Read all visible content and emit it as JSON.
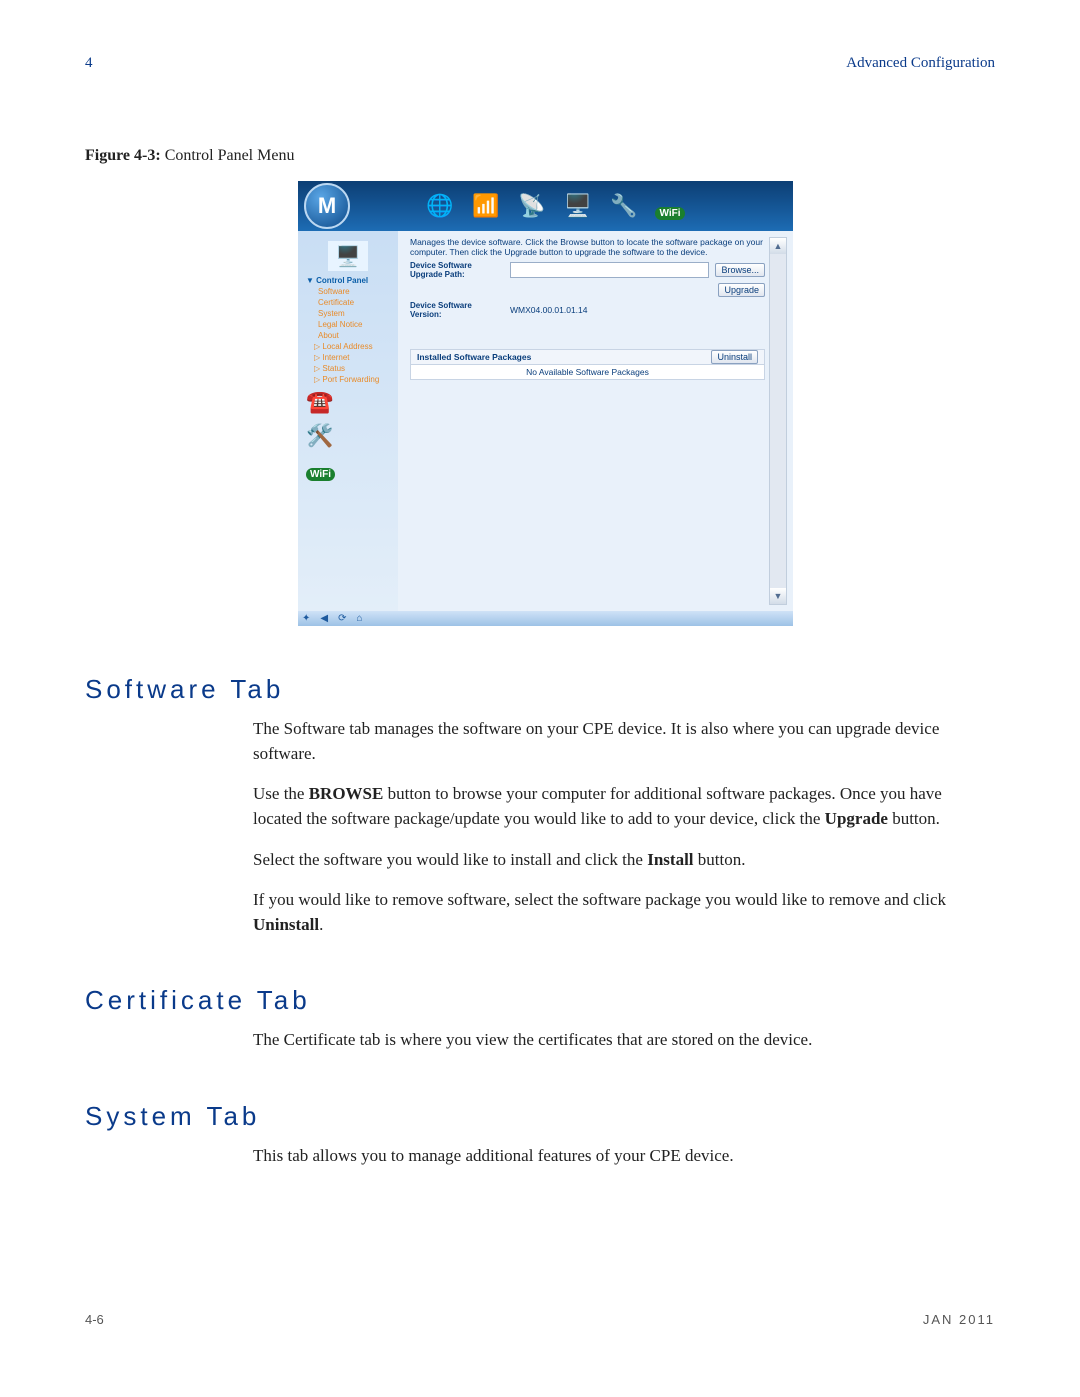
{
  "header": {
    "page_number": "4",
    "chapter_header": "Advanced Configuration"
  },
  "figure": {
    "caption_label": "Figure 4-3:",
    "caption_text": "Control Panel Menu"
  },
  "screenshot": {
    "header_icons": [
      "globe-icon",
      "signal-icon",
      "antenna-icon",
      "monitor-icon",
      "close-icon",
      "wifi-icon"
    ],
    "wifi_text": "WiFi",
    "sidebar": {
      "top_label": "Control Panel",
      "items": [
        "Software",
        "Certificate",
        "System",
        "Legal Notice",
        "About"
      ],
      "secondary": [
        "Local Address",
        "Internet",
        "Status",
        "Port Forwarding"
      ]
    },
    "main": {
      "desc": "Manages the device software. Click the Browse button to locate the software package on your computer. Then click the Upgrade button to upgrade the software to the device.",
      "path_label": "Device Software Upgrade Path:",
      "browse_btn": "Browse...",
      "upgrade_btn": "Upgrade",
      "version_label": "Device Software Version:",
      "version_value": "WMX04.00.01.01.14",
      "packages_label": "Installed Software Packages",
      "uninstall_btn": "Uninstall",
      "no_packages": "No Available Software Packages"
    }
  },
  "sections": {
    "software": {
      "heading": "Software Tab",
      "p1": "The Software tab manages the software on your CPE device. It is also where you can upgrade device software.",
      "p2a": "Use the ",
      "p2b_bold": "BROWSE",
      "p2c": " button to browse your computer for additional software packages. Once you have located the software package/update you would like to add to your device, click the ",
      "p2d_bold": "Upgrade",
      "p2e": " button.",
      "p3a": "Select the software you would like to install and click the ",
      "p3b_bold": "Install",
      "p3c": " button.",
      "p4a": "If you would like to remove software, select the software package you would like to remove and click ",
      "p4b_bold": "Uninstall",
      "p4c": "."
    },
    "certificate": {
      "heading": "Certificate Tab",
      "p1": "The Certificate tab is where you view the certificates that are stored on the device."
    },
    "system": {
      "heading": "System Tab",
      "p1": "This tab allows you to manage additional features of your CPE device."
    }
  },
  "footer": {
    "left": "4-6",
    "right": "JAN 2011"
  }
}
